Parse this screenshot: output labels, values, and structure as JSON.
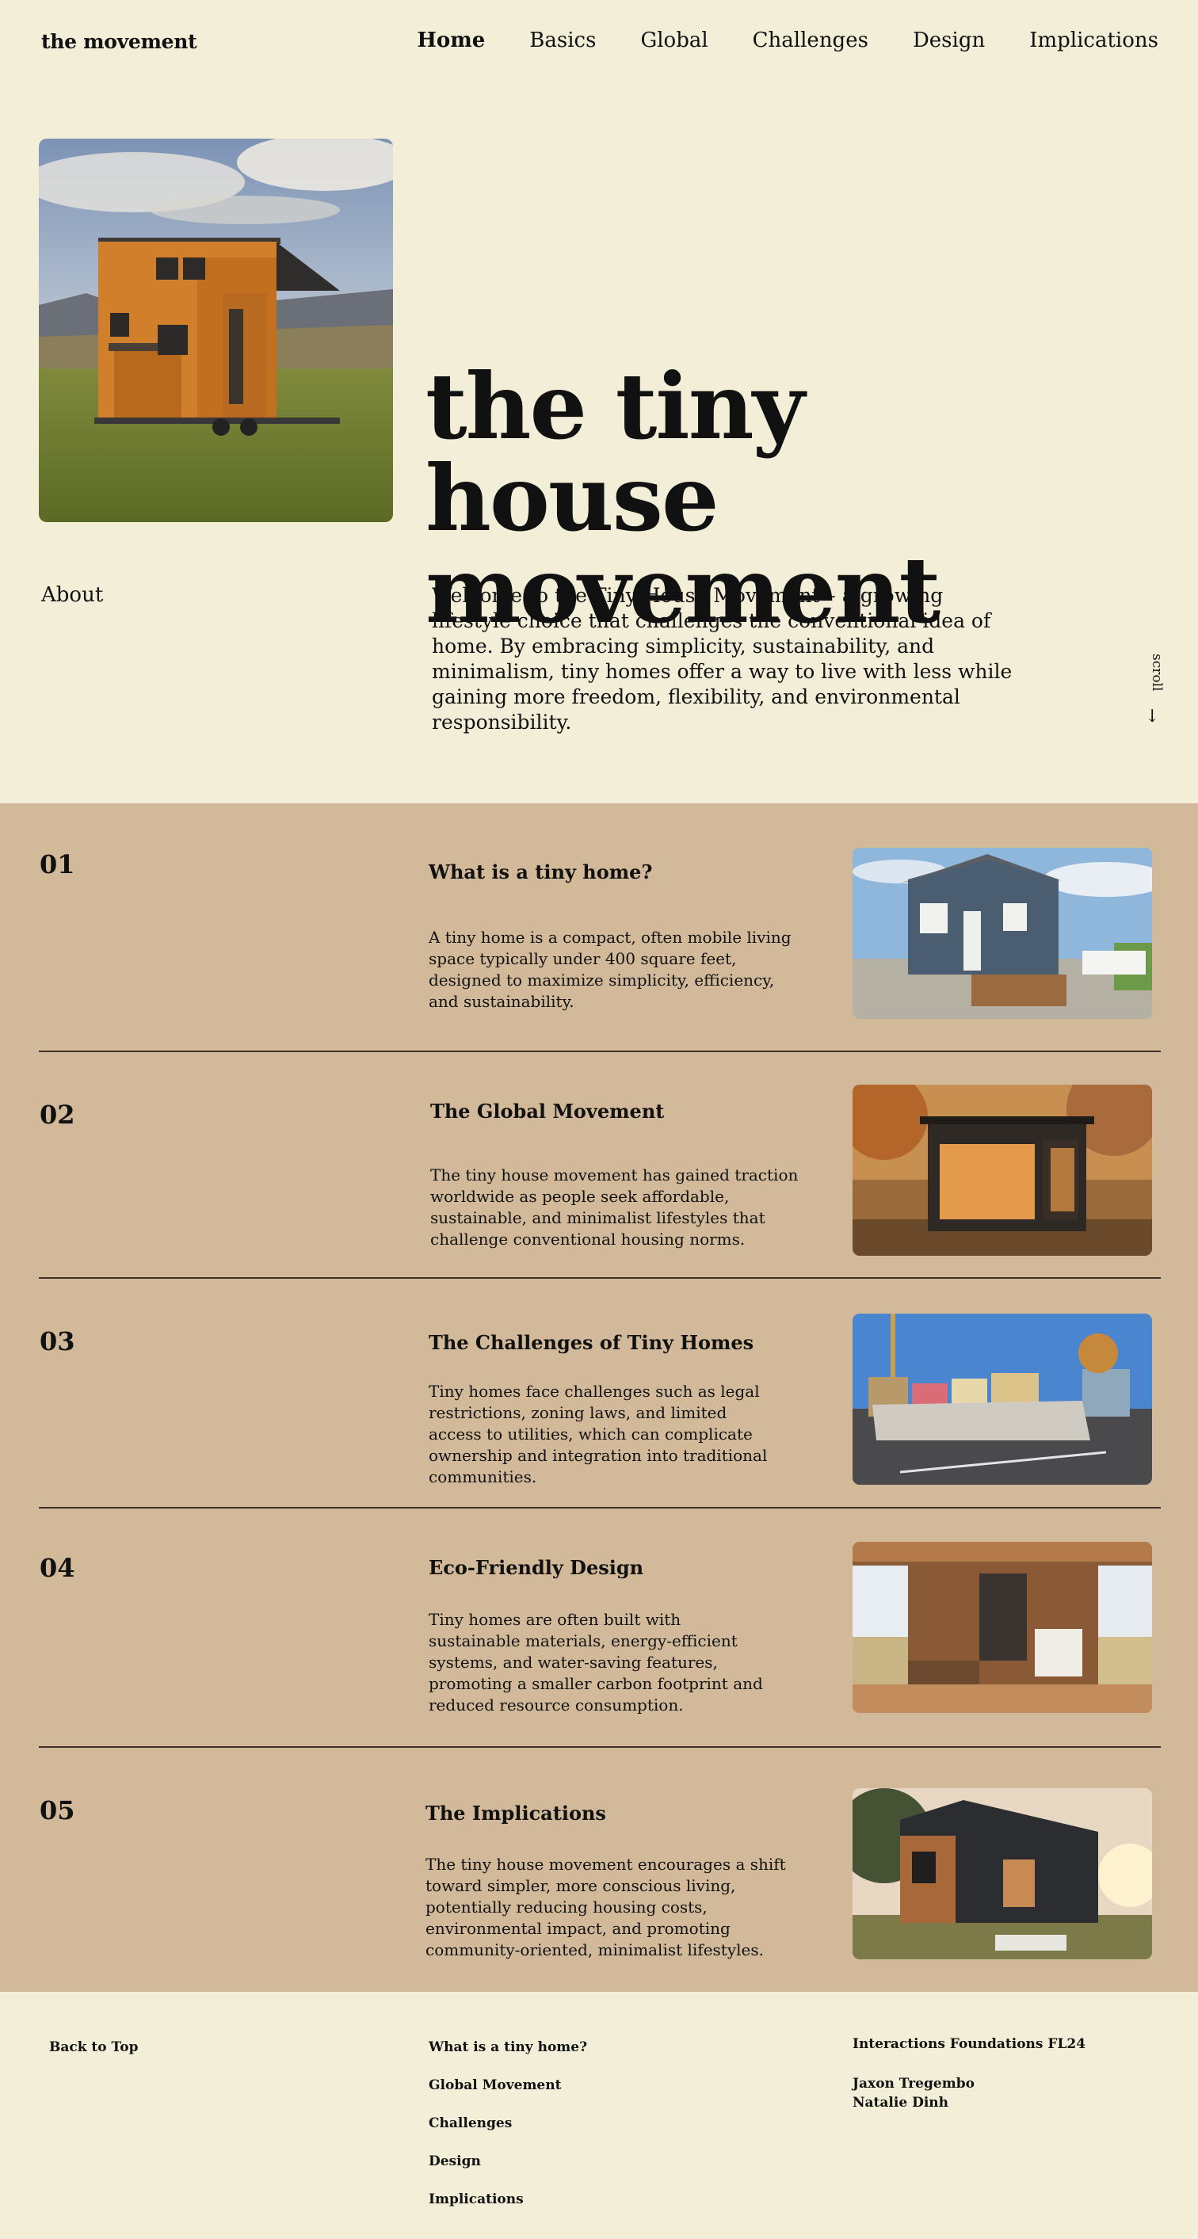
{
  "header": {
    "brand": "the movement",
    "nav": [
      "Home",
      "Basics",
      "Global",
      "Challenges",
      "Design",
      "Implications"
    ]
  },
  "hero": {
    "title_line1": "the tiny house",
    "title_line2": "movement",
    "image_icon": "tiny-house-photo"
  },
  "about": {
    "label": "About",
    "text": "Welcome to the Tiny House Movement – a growing lifestyle choice that challenges the conventional idea of home. By embracing simplicity, sustainability, and minimalism, tiny homes offer a way to live with less while gaining more freedom, flexibility, and environmental responsibility.",
    "scroll_label": "scroll",
    "scroll_icon": "arrow-down-icon"
  },
  "sections": [
    {
      "num": "01",
      "title": "What is a tiny home?",
      "text": "A tiny home is a compact, often mobile living space typically under 400 square feet, designed to maximize simplicity, efficiency, and sustainability."
    },
    {
      "num": "02",
      "title": "The Global Movement",
      "text": "The tiny house movement has gained traction worldwide as people seek affordable, sustainable, and minimalist lifestyles that challenge conventional housing norms."
    },
    {
      "num": "03",
      "title": "The Challenges of Tiny Homes",
      "text": "Tiny homes face challenges such as legal restrictions, zoning laws, and limited access to utilities, which can complicate ownership and integration into traditional communities."
    },
    {
      "num": "04",
      "title": "Eco-Friendly Design",
      "text": "Tiny homes are often built with sustainable materials, energy-efficient systems, and water-saving features, promoting a smaller carbon footprint and reduced resource consumption."
    },
    {
      "num": "05",
      "title": "The Implications",
      "text": "The tiny house movement encourages a shift toward simpler, more conscious living, potentially reducing housing costs, environmental impact, and promoting community-oriented, minimalist lifestyles."
    }
  ],
  "footer": {
    "back_to_top": "Back to Top",
    "links": [
      "What is a tiny home?",
      "Global Movement",
      "Challenges",
      "Design",
      "Implications"
    ],
    "course": "Interactions Foundations FL24",
    "authors": [
      "Jaxon Tregembo",
      "Natalie Dinh"
    ]
  }
}
